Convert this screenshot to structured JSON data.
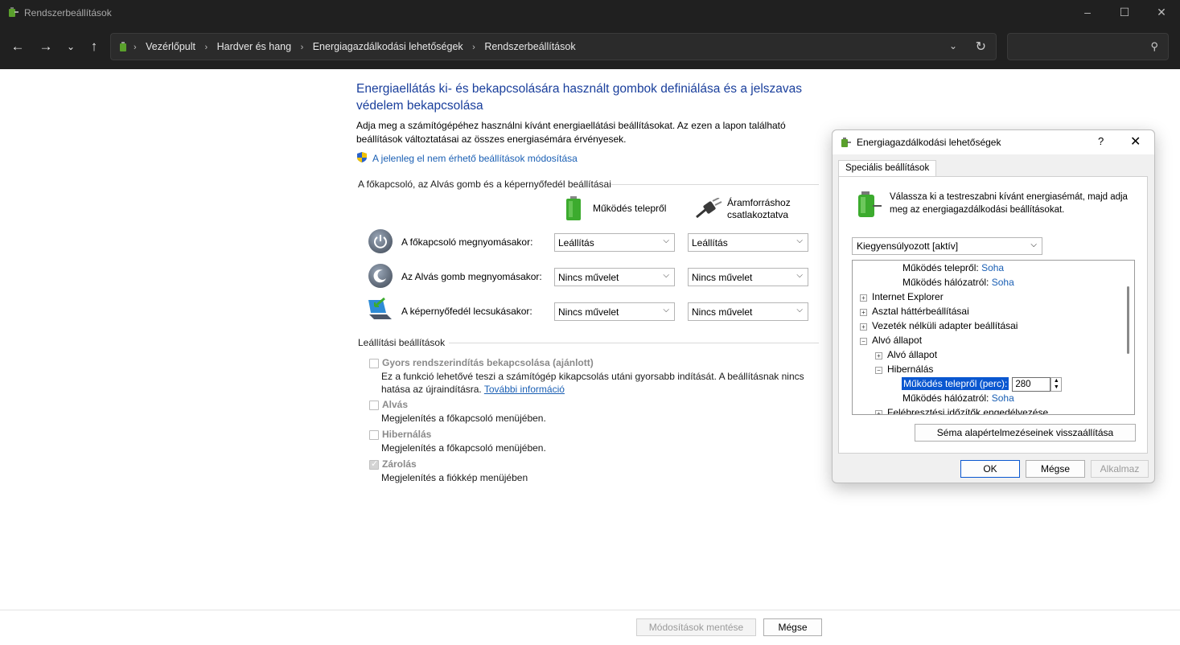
{
  "window": {
    "title": "Rendszerbeállítások"
  },
  "address": {
    "crumbs": [
      "Vezérlőpult",
      "Hardver és hang",
      "Energiagazdálkodási lehetőségek",
      "Rendszerbeállítások"
    ],
    "search_placeholder": ""
  },
  "main": {
    "heading": "Energiaellátás ki- és bekapcsolására használt gombok definiálása és a jelszavas védelem bekapcsolása",
    "description": "Adja meg a számítógépéhez használni kívánt energiaellátási beállításokat. Az ezen a lapon található beállítások változtatásai az összes energiasémára érvényesek.",
    "change_link": "A jelenleg el nem érhető beállítások módosítása",
    "buttons_group_title": "A főkapcsoló, az Alvás gomb és a képernyőfedél beállításai",
    "col_battery": "Működés telepről",
    "col_plugged_1": "Áramforráshoz",
    "col_plugged_2": "csatlakoztatva",
    "rows": [
      {
        "label": "A főkapcsoló megnyomásakor:",
        "battery": "Leállítás",
        "plugged": "Leállítás"
      },
      {
        "label": "Az Alvás gomb megnyomásakor:",
        "battery": "Nincs művelet",
        "plugged": "Nincs művelet"
      },
      {
        "label": "A képernyőfedél lecsukásakor:",
        "battery": "Nincs művelet",
        "plugged": "Nincs művelet"
      }
    ],
    "shutdown_group_title": "Leállítási beállítások",
    "options": [
      {
        "label": "Gyors rendszerindítás bekapcsolása (ajánlott)",
        "desc1": "Ez a funkció lehetővé teszi a számítógép kikapcsolás utáni gyorsabb indítását. A beállításnak nincs",
        "desc2": "hatása az újraindításra. ",
        "link": "További információ",
        "checked": false
      },
      {
        "label": "Alvás",
        "desc1": "Megjelenítés a főkapcsoló menüjében.",
        "checked": false
      },
      {
        "label": "Hibernálás",
        "desc1": "Megjelenítés a főkapcsoló menüjében.",
        "checked": false
      },
      {
        "label": "Zárolás",
        "desc1": "Megjelenítés a fiókkép menüjében",
        "checked": true
      }
    ]
  },
  "footer": {
    "save": "Módosítások mentése",
    "cancel": "Mégse"
  },
  "dialog": {
    "title": "Energiagazdálkodási lehetőségek",
    "help": "?",
    "tab": "Speciális beállítások",
    "intro": "Válassza ki a testreszabni kívánt energiasémát, majd adja meg az energiagazdálkodási beállításokat.",
    "plan": "Kiegyensúlyozott [aktív]",
    "tree": {
      "r1_label": "Működés telepről: ",
      "r1_val": "Soha",
      "r2_label": "Működés hálózatról: ",
      "r2_val": "Soha",
      "r3": "Internet Explorer",
      "r4": "Asztal háttérbeállításai",
      "r5": "Vezeték nélküli adapter beállításai",
      "r6": "Alvó állapot",
      "r7": "Alvó állapot",
      "r8": "Hibernálás",
      "r9_label": "Működés telepről (perc):",
      "r9_val": "280",
      "r10_label": "Működés hálózatról: ",
      "r10_val": "Soha",
      "r11": "Felébresztési időzítők engedélyezése"
    },
    "restore": "Séma alapértelmezéseinek visszaállítása",
    "ok": "OK",
    "cancel": "Mégse",
    "apply": "Alkalmaz"
  }
}
